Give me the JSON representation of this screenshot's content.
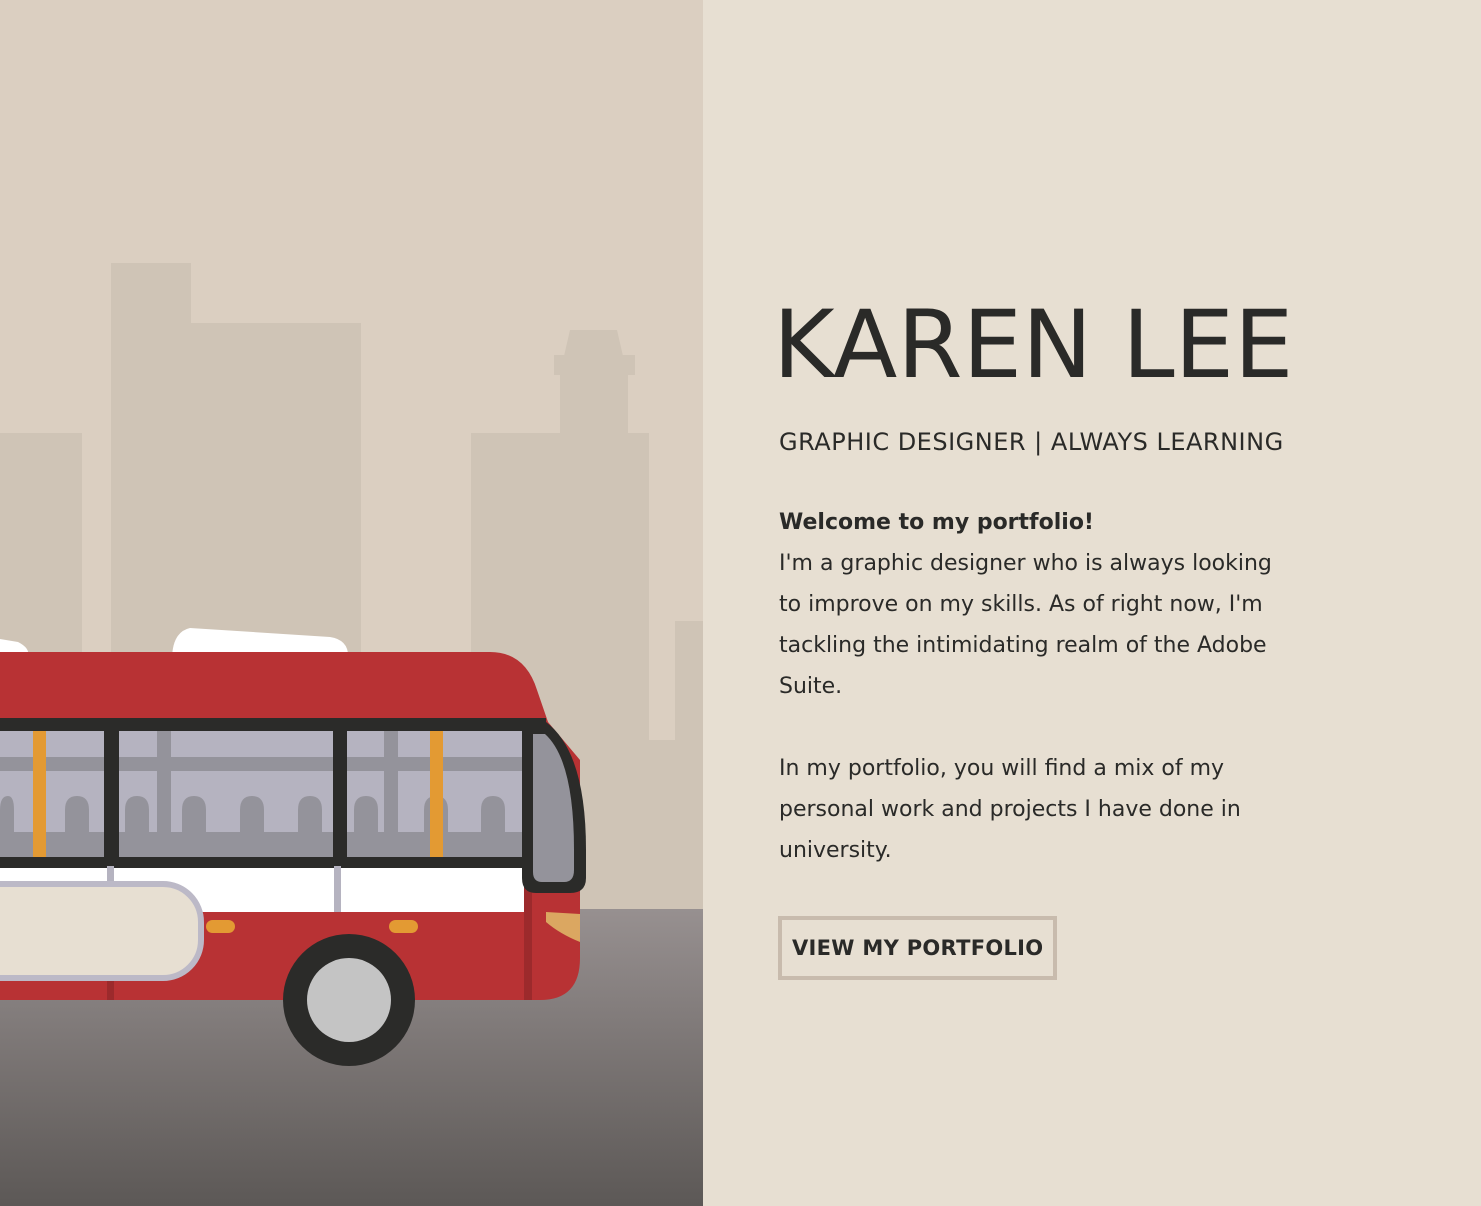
{
  "profile": {
    "name": "KAREN LEE",
    "tagline": "GRAPHIC DESIGNER | ALWAYS LEARNING"
  },
  "intro": {
    "welcome": "Welcome to my portfolio!",
    "paragraph_1": "I'm a graphic designer who is always looking to improve on my skills. As of right now, I'm tackling the intimidating realm of the Adobe Suite.",
    "paragraph_2": "In my portfolio, you will find a mix of my personal work and projects I have done in university."
  },
  "cta": {
    "label": "VIEW MY PORTFOLIO"
  },
  "colors": {
    "panel_background": "#e7dfd2",
    "sky": "#dbcfc1",
    "buildings": "#cfc4b6",
    "road_top": "#979090",
    "road_bottom": "#5c5856",
    "bus_red": "#b83234",
    "bus_outline": "#2b2b29",
    "window_glass": "#b5b3c0",
    "accent_orange": "#e39a33",
    "text": "#2a2a28",
    "button_border": "#c8bbad"
  }
}
